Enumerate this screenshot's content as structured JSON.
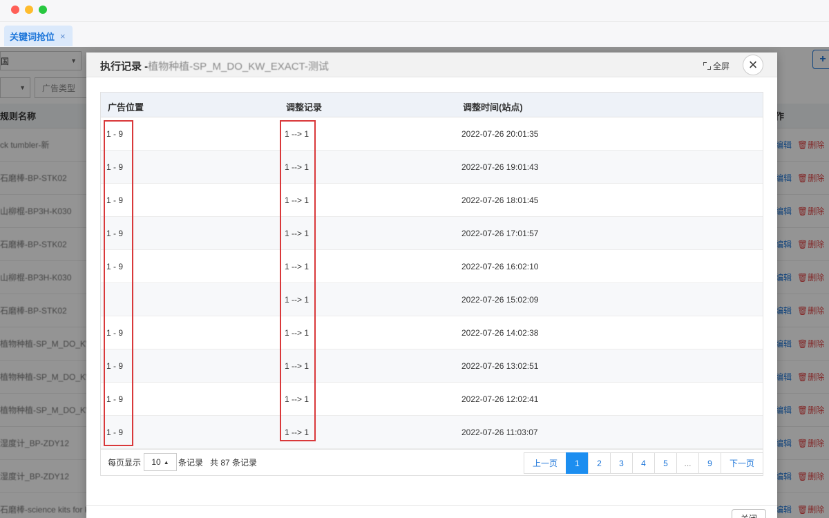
{
  "window": {
    "tab_label": "关键词抢位",
    "tab_close": "×"
  },
  "background": {
    "country": "国",
    "ad_type_placeholder": "广告类型",
    "column_rule_name": "规则名称",
    "column_ops": "作",
    "add_button": "+",
    "rows": [
      {
        "name": "ck tumbler-新",
        "edit": "编辑",
        "delete": "删除"
      },
      {
        "name": "石磨棒-BP-STK02",
        "edit": "编辑",
        "delete": "删除"
      },
      {
        "name": "山柳棍-BP3H-K030",
        "edit": "编辑",
        "delete": "删除"
      },
      {
        "name": "石磨棒-BP-STK02",
        "edit": "编辑",
        "delete": "删除"
      },
      {
        "name": "山柳棍-BP3H-K030",
        "edit": "编辑",
        "delete": "删除"
      },
      {
        "name": "石磨棒-BP-STK02",
        "edit": "编辑",
        "delete": "删除"
      },
      {
        "name": "植物种植-SP_M_DO_KW_E",
        "edit": "编辑",
        "delete": "删除"
      },
      {
        "name": "植物种植-SP_M_DO_KW_P",
        "edit": "编辑",
        "delete": "删除"
      },
      {
        "name": "植物种植-SP_M_DO_KW_E",
        "edit": "编辑",
        "delete": "删除"
      },
      {
        "name": "湿度计_BP-ZDY12",
        "edit": "编辑",
        "delete": "删除"
      },
      {
        "name": "湿度计_BP-ZDY12",
        "edit": "编辑",
        "delete": "删除"
      },
      {
        "name": "石磨棒-science kits for k",
        "edit": "编辑",
        "delete": "删除"
      }
    ]
  },
  "modal": {
    "title": "执行记录 - ",
    "title_sub": "植物种植-SP_M_DO_KW_EXACT-测试",
    "fullscreen_label": "全屏",
    "close_glyph": "×",
    "columns": [
      "广告位置",
      "调整记录",
      "调整时间(站点)"
    ],
    "rows": [
      {
        "position": "1 - 9",
        "adjust": "1 --> 1",
        "time": "2022-07-26 20:01:35"
      },
      {
        "position": "1 - 9",
        "adjust": "1 --> 1",
        "time": "2022-07-26 19:01:43"
      },
      {
        "position": "1 - 9",
        "adjust": "1 --> 1",
        "time": "2022-07-26 18:01:45"
      },
      {
        "position": "1 - 9",
        "adjust": "1 --> 1",
        "time": "2022-07-26 17:01:57"
      },
      {
        "position": "1 - 9",
        "adjust": "1 --> 1",
        "time": "2022-07-26 16:02:10"
      },
      {
        "position": "",
        "adjust": "1 --> 1",
        "time": "2022-07-26 15:02:09"
      },
      {
        "position": "1 - 9",
        "adjust": "1 --> 1",
        "time": "2022-07-26 14:02:38"
      },
      {
        "position": "1 - 9",
        "adjust": "1 --> 1",
        "time": "2022-07-26 13:02:51"
      },
      {
        "position": "1 - 9",
        "adjust": "1 --> 1",
        "time": "2022-07-26 12:02:41"
      },
      {
        "position": "1 - 9",
        "adjust": "1 --> 1",
        "time": "2022-07-26 11:03:07"
      }
    ],
    "pagination": {
      "per_page_label": "每页显示",
      "per_page_value": "10",
      "records_suffix": "条记录",
      "total_text": "共 87 条记录",
      "prev": "上一页",
      "next": "下一页",
      "pages": [
        "1",
        "2",
        "3",
        "4",
        "5",
        "...",
        "9"
      ],
      "current": "1"
    },
    "footer_button": "关闭"
  },
  "colors": {
    "accent": "#1c8ef0",
    "highlight_box": "#d9383a",
    "delete": "#e04646"
  }
}
